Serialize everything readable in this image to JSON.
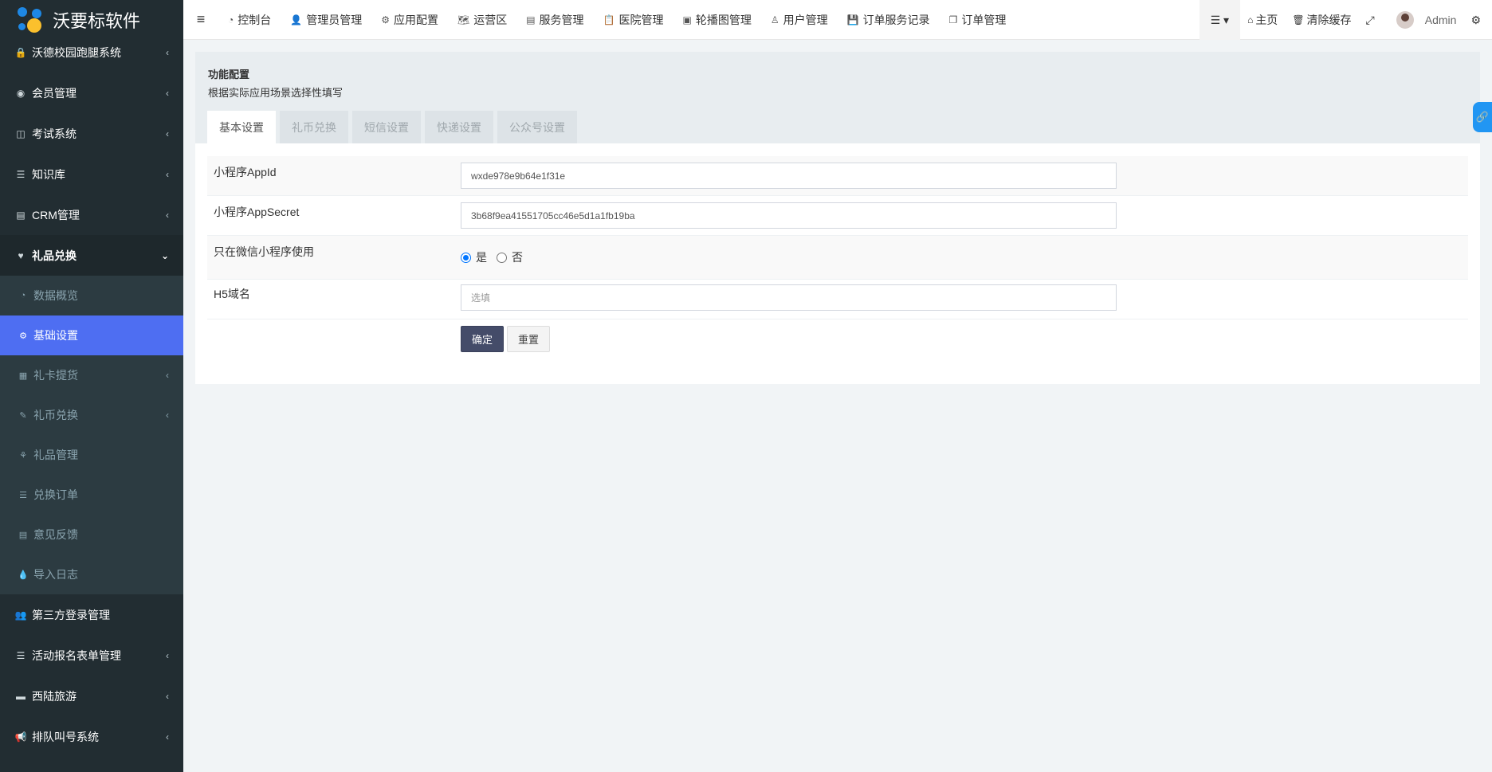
{
  "app": {
    "title": "沃要标软件"
  },
  "sidebar": {
    "items_top": [
      {
        "label": "沃德校园跑腿系统",
        "icon": "lock-icon",
        "glyph": "🔒"
      },
      {
        "label": "会员管理",
        "icon": "user-circle-icon",
        "glyph": "◉"
      },
      {
        "label": "考试系统",
        "icon": "columns-icon",
        "glyph": "◫"
      },
      {
        "label": "知识库",
        "icon": "list-icon",
        "glyph": "☰"
      },
      {
        "label": "CRM管理",
        "icon": "id-card-icon",
        "glyph": "▤"
      }
    ],
    "open_item": {
      "label": "礼品兑换",
      "icon": "heart-icon",
      "glyph": "♥"
    },
    "sub_items": [
      {
        "label": "数据概览",
        "icon": "dashboard-icon",
        "glyph": "◔",
        "chevron": false
      },
      {
        "label": "基础设置",
        "icon": "cogs-icon",
        "glyph": "⚙",
        "chevron": false,
        "active": true
      },
      {
        "label": "礼卡提货",
        "icon": "archive-icon",
        "glyph": "▦",
        "chevron": true
      },
      {
        "label": "礼币兑换",
        "icon": "pencil-icon",
        "glyph": "✎",
        "chevron": true
      },
      {
        "label": "礼品管理",
        "icon": "gift-icon",
        "glyph": "⚘",
        "chevron": false
      },
      {
        "label": "兑换订单",
        "icon": "list-icon",
        "glyph": "☰",
        "chevron": false
      },
      {
        "label": "意见反馈",
        "icon": "table-icon",
        "glyph": "▤",
        "chevron": false
      },
      {
        "label": "导入日志",
        "icon": "tint-icon",
        "glyph": "💧",
        "chevron": false
      }
    ],
    "items_bottom": [
      {
        "label": "第三方登录管理",
        "icon": "users-icon",
        "glyph": "👥",
        "chevron": false
      },
      {
        "label": "活动报名表单管理",
        "icon": "list-icon",
        "glyph": "☰",
        "chevron": true
      },
      {
        "label": "西陆旅游",
        "icon": "folder-icon",
        "glyph": "▬",
        "chevron": true
      },
      {
        "label": "排队叫号系统",
        "icon": "bullhorn-icon",
        "glyph": "📢",
        "chevron": true
      }
    ]
  },
  "topbar": {
    "tabs": [
      {
        "label": "控制台",
        "icon": "dashboard-icon",
        "glyph": "◔"
      },
      {
        "label": "管理员管理",
        "icon": "user-icon",
        "glyph": "👤"
      },
      {
        "label": "应用配置",
        "icon": "gear-icon",
        "glyph": "⚙"
      },
      {
        "label": "运营区",
        "icon": "map-icon",
        "glyph": "🗺"
      },
      {
        "label": "服务管理",
        "icon": "list-alt-icon",
        "glyph": "▤"
      },
      {
        "label": "医院管理",
        "icon": "clipboard-icon",
        "glyph": "📋"
      },
      {
        "label": "轮播图管理",
        "icon": "image-icon",
        "glyph": "▣"
      },
      {
        "label": "用户管理",
        "icon": "user-outline-icon",
        "glyph": "♙"
      },
      {
        "label": "订单服务记录",
        "icon": "save-icon",
        "glyph": "💾"
      },
      {
        "label": "订单管理",
        "icon": "copy-icon",
        "glyph": "❐"
      }
    ],
    "right": {
      "home": "主页",
      "clear_cache": "清除缓存",
      "user": "Admin"
    }
  },
  "panel": {
    "title": "功能配置",
    "subtitle": "根据实际应用场景选择性填写",
    "tabs": [
      "基本设置",
      "礼币兑换",
      "短信设置",
      "快递设置",
      "公众号设置"
    ],
    "active_tab": 0
  },
  "form": {
    "appid_label": "小程序AppId",
    "appid_value": "wxde978e9b64e1f31e",
    "secret_label": "小程序AppSecret",
    "secret_value": "3b68f9ea41551705cc46e5d1a1fb19ba",
    "only_wx_label": "只在微信小程序使用",
    "radio_yes": "是",
    "radio_no": "否",
    "radio_selected": "yes",
    "h5_label": "H5域名",
    "h5_placeholder": "选填",
    "submit": "确定",
    "reset": "重置"
  },
  "colors": {
    "sidebar_bg": "#222d32",
    "active": "#4e6ef2",
    "primary_btn": "#444c69"
  }
}
